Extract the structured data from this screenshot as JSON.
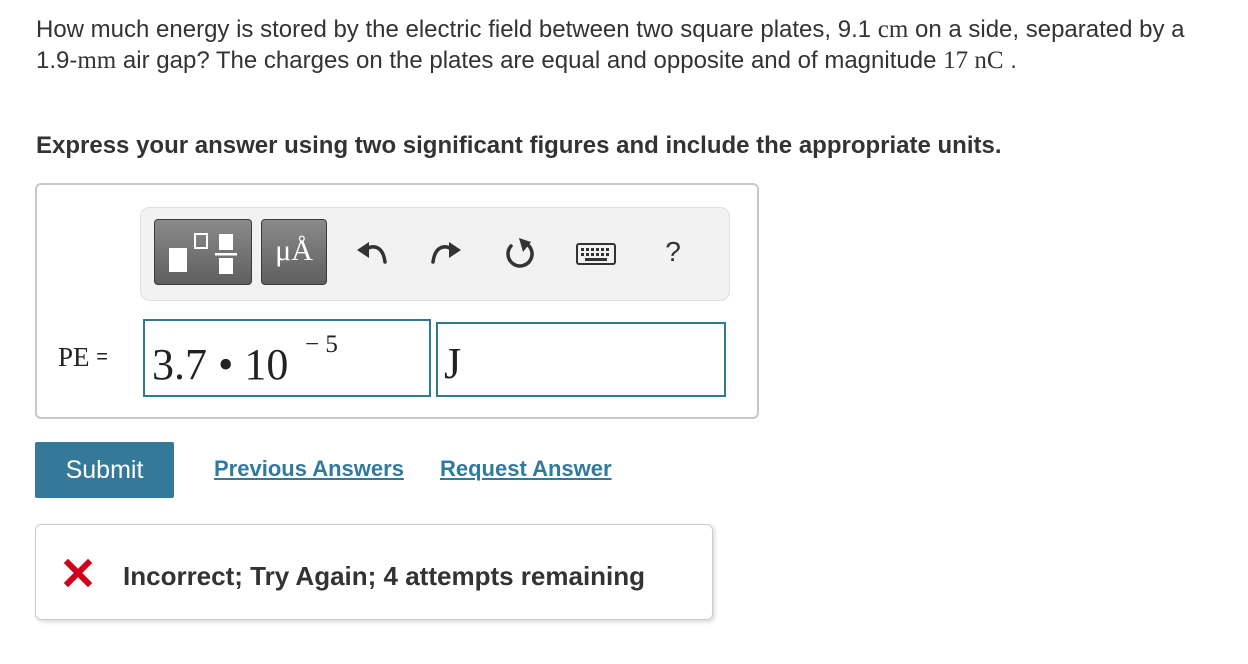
{
  "question": {
    "part1": "How much energy is stored by the electric field between two square plates, 9.1 ",
    "unit_cm": "cm",
    "part2": " on a side, separated by a 1.9-",
    "unit_mm": "mm",
    "part3": " air gap? The charges on the plates are equal and opposite and of magnitude ",
    "charge": "17 ",
    "unit_nc": "nC",
    "part4": " ."
  },
  "instruction": "Express your answer using two significant figures and include the appropriate units.",
  "toolbar": {
    "units_label": "μÅ",
    "help_label": "?",
    "icons": [
      "templates-icon",
      "units-icon",
      "undo-icon",
      "redo-icon",
      "reset-icon",
      "keyboard-icon",
      "help-icon"
    ]
  },
  "answer": {
    "label": "PE",
    "equals": "=",
    "value_mantissa": "3.7 • 10",
    "value_exponent": "− 5",
    "unit": "J"
  },
  "actions": {
    "submit_label": "Submit",
    "previous_answers_label": "Previous Answers",
    "request_answer_label": "Request Answer"
  },
  "feedback": {
    "message": "Incorrect; Try Again; 4 attempts remaining",
    "icon_color": "#d0021b"
  },
  "colors": {
    "accent": "#347a98",
    "link": "#2f7a9e",
    "field_border": "#2f7a8e"
  }
}
